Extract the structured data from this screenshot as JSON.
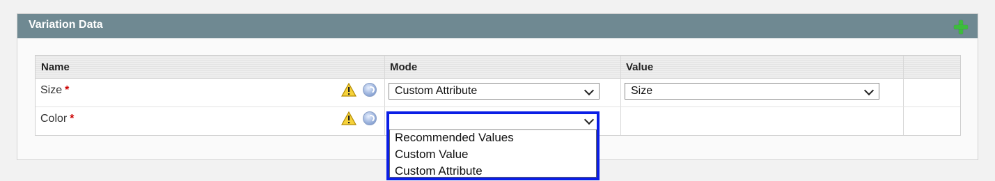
{
  "panel": {
    "title": "Variation Data"
  },
  "table": {
    "headers": {
      "name": "Name",
      "mode": "Mode",
      "value": "Value"
    },
    "rows": [
      {
        "name": "Size",
        "required": "*",
        "mode": "Custom Attribute",
        "value": "Size"
      },
      {
        "name": "Color",
        "required": "*",
        "mode": "",
        "value": ""
      }
    ]
  },
  "dropdown": {
    "options": [
      "Recommended Values",
      "Custom Value",
      "Custom Attribute"
    ]
  },
  "colors": {
    "header_bg": "#6f8992",
    "highlight": "#0a1ee6",
    "add_icon": "#3dbb3d",
    "required": "#cc0000"
  },
  "icons": [
    "plus-icon",
    "warning-icon",
    "help-icon",
    "chevron-down-icon"
  ]
}
